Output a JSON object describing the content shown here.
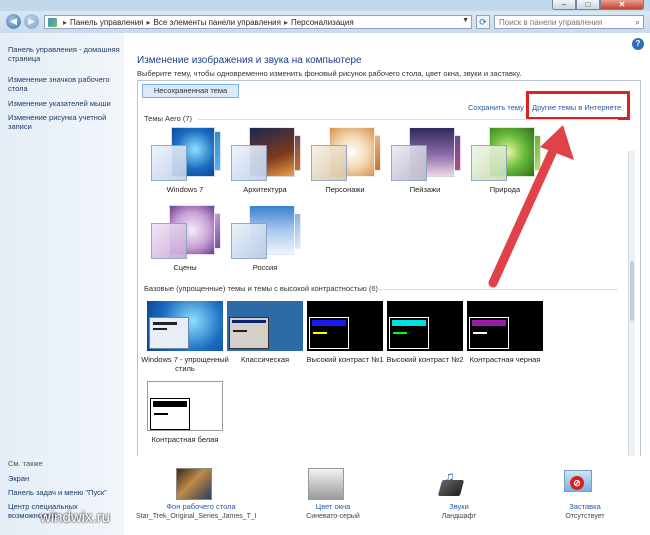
{
  "address": {
    "crumbs": [
      "Панель управления",
      "Все элементы панели управления",
      "Персонализация"
    ],
    "search_placeholder": "Поиск в панели управления"
  },
  "sidebar": {
    "home": "Панель управления - домашняя страница",
    "links": [
      "Изменение значков рабочего стола",
      "Изменение указателей мыши",
      "Изменение рисунка учетной записи"
    ],
    "see_also": "См. также",
    "also_links": [
      "Экран",
      "Панель задач и меню \"Пуск\"",
      "Центр специальных возможностей"
    ]
  },
  "main": {
    "heading": "Изменение изображения и звука на компьютере",
    "subheading": "Выберите тему, чтобы одновременно изменить фоновый рисунок рабочего стола, цвет окна, звуки и заставку.",
    "unsaved_theme": "Несохраненная тема",
    "save_theme": "Сохранить тему",
    "more_themes": "Другие темы в Интернете",
    "aero_section": "Темы Aero (7)",
    "basic_section": "Базовые (упрощенные) темы и темы с высокой контрастностью (6)",
    "aero_themes": [
      "Windows 7",
      "Архитектура",
      "Персонажи",
      "Пейзажи",
      "Природа",
      "Сцены",
      "Россия"
    ],
    "basic_themes": [
      "Windows 7 - упрощенный стиль",
      "Классическая",
      "Высокий контраст №1",
      "Высокий контраст №2",
      "Контрастная черная",
      "Контрастная белая"
    ]
  },
  "bottom": {
    "wallpaper": {
      "label": "Фон рабочего стола",
      "value": "Star_Trek_Original_Series_James_T_Ki..."
    },
    "color": {
      "label": "Цвет окна",
      "value": "Синевато-серый"
    },
    "sounds": {
      "label": "Звуки",
      "value": "Ландшафт"
    },
    "screensaver": {
      "label": "Заставка",
      "value": "Отсутствует"
    }
  },
  "watermark": "windwix.ru",
  "colors": {
    "highlight": "#dd2020",
    "link": "#2458a6",
    "heading": "#1e3e8b",
    "arrow": "#e0424a"
  }
}
